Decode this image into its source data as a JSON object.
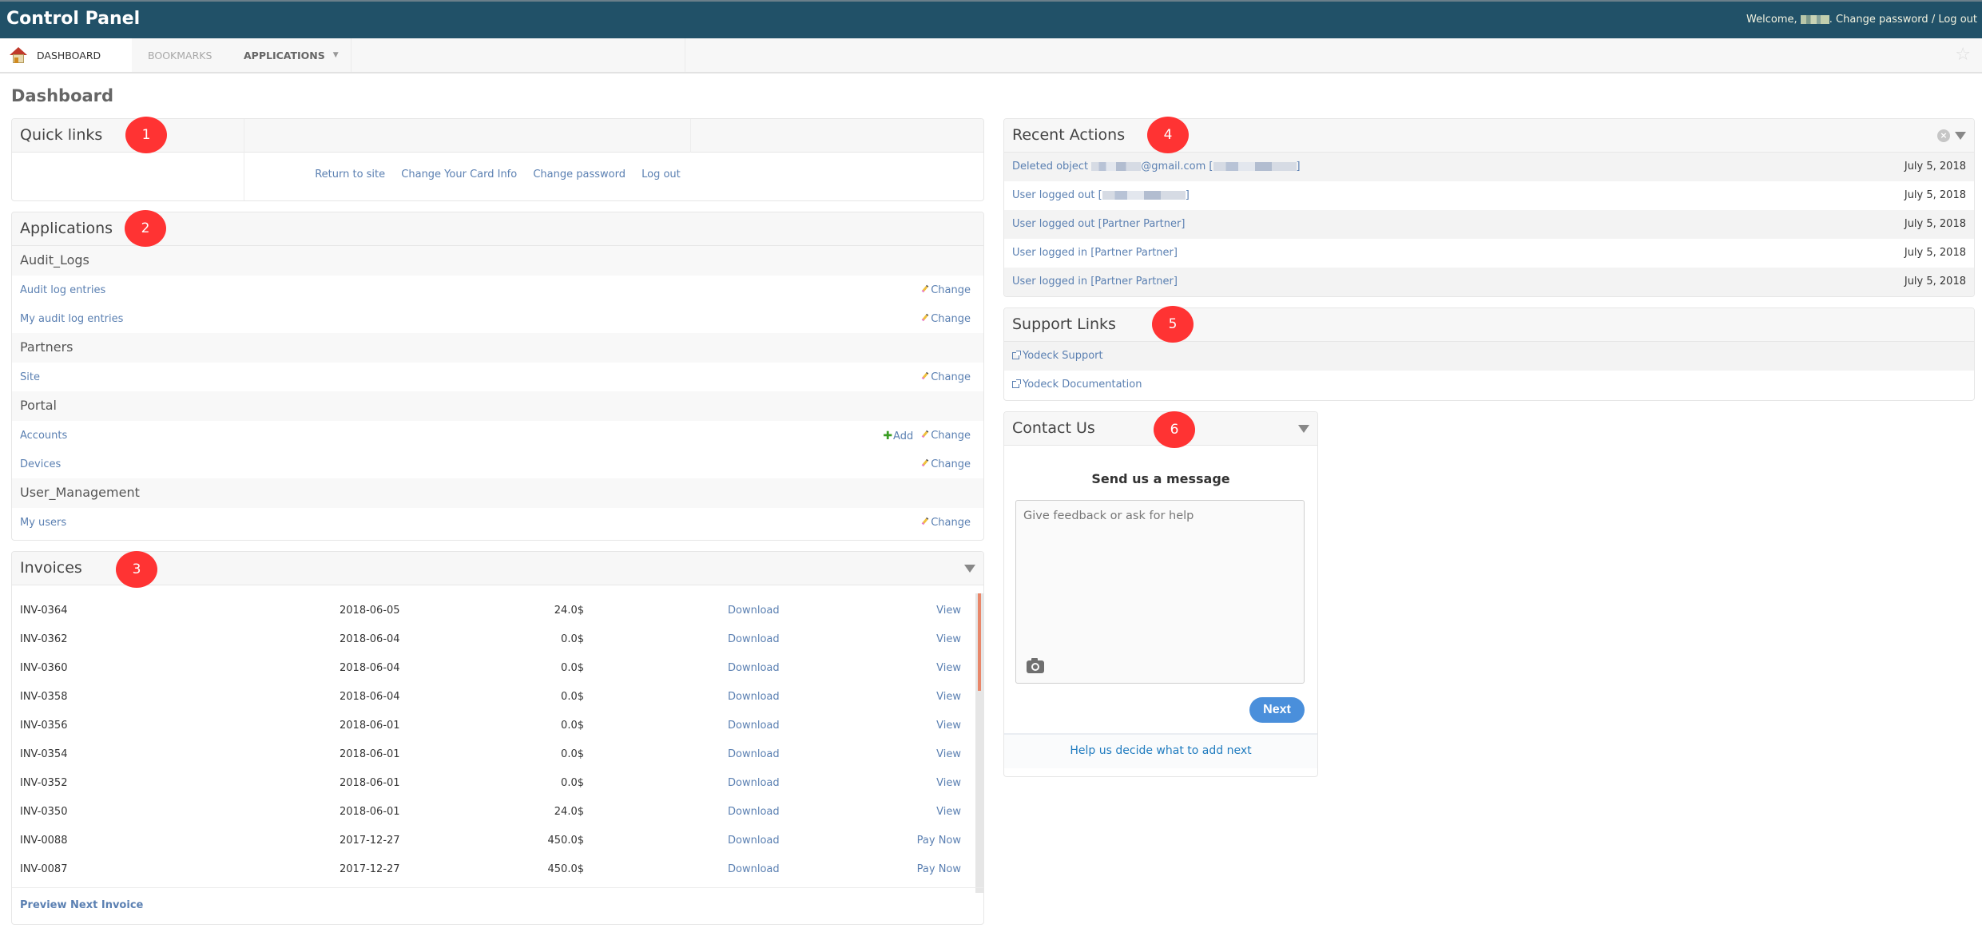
{
  "header": {
    "title": "Control Panel",
    "welcome_prefix": "Welcome,",
    "welcome_suffix": ".",
    "change_password": "Change password",
    "separator": "/",
    "log_out": "Log out"
  },
  "nav": {
    "tabs": [
      {
        "label": "DASHBOARD",
        "icon": "home-icon",
        "active": true
      },
      {
        "label": "BOOKMARKS"
      },
      {
        "label": "APPLICATIONS",
        "icon": "caret-down-icon"
      }
    ],
    "bookmark_icon": "star-icon"
  },
  "page": {
    "title": "Dashboard"
  },
  "colors": {
    "header_bg": "#215168",
    "link": "#5b80b2",
    "badge": "#ff3333",
    "next_button": "#4a8fdb",
    "scroll_thumb": "#e9876a"
  },
  "quick_links": {
    "title": "Quick links",
    "badge": "1",
    "links": [
      "Return to site",
      "Change Your Card Info",
      "Change password",
      "Log out"
    ]
  },
  "applications": {
    "title": "Applications",
    "badge": "2",
    "groups": [
      {
        "name": "Audit_Logs",
        "models": [
          {
            "name": "Audit log entries",
            "actions": [
              "Change"
            ]
          },
          {
            "name": "My audit log entries",
            "actions": [
              "Change"
            ]
          }
        ]
      },
      {
        "name": "Partners",
        "models": [
          {
            "name": "Site",
            "actions": [
              "Change"
            ]
          }
        ]
      },
      {
        "name": "Portal",
        "models": [
          {
            "name": "Accounts",
            "add": "Add",
            "actions": [
              "Change"
            ]
          },
          {
            "name": "Devices",
            "actions": [
              "Change"
            ]
          }
        ]
      },
      {
        "name": "User_Management",
        "models": [
          {
            "name": "My users",
            "actions": [
              "Change"
            ]
          }
        ]
      }
    ]
  },
  "invoices": {
    "title": "Invoices",
    "badge": "3",
    "rows": [
      {
        "id": "INV-0364",
        "date": "2018-06-05",
        "amount": "24.0$",
        "download": "Download",
        "action": "View"
      },
      {
        "id": "INV-0362",
        "date": "2018-06-04",
        "amount": "0.0$",
        "download": "Download",
        "action": "View"
      },
      {
        "id": "INV-0360",
        "date": "2018-06-04",
        "amount": "0.0$",
        "download": "Download",
        "action": "View"
      },
      {
        "id": "INV-0358",
        "date": "2018-06-04",
        "amount": "0.0$",
        "download": "Download",
        "action": "View"
      },
      {
        "id": "INV-0356",
        "date": "2018-06-01",
        "amount": "0.0$",
        "download": "Download",
        "action": "View"
      },
      {
        "id": "INV-0354",
        "date": "2018-06-01",
        "amount": "0.0$",
        "download": "Download",
        "action": "View"
      },
      {
        "id": "INV-0352",
        "date": "2018-06-01",
        "amount": "0.0$",
        "download": "Download",
        "action": "View"
      },
      {
        "id": "INV-0350",
        "date": "2018-06-01",
        "amount": "24.0$",
        "download": "Download",
        "action": "View"
      },
      {
        "id": "INV-0088",
        "date": "2017-12-27",
        "amount": "450.0$",
        "download": "Download",
        "action": "Pay Now"
      },
      {
        "id": "INV-0087",
        "date": "2017-12-27",
        "amount": "450.0$",
        "download": "Download",
        "action": "Pay Now"
      }
    ],
    "footer_link": "Preview Next Invoice"
  },
  "recent_actions": {
    "title": "Recent Actions",
    "badge": "4",
    "rows": [
      {
        "prefix": "Deleted object ",
        "mid": "@gmail.com [",
        "suffix": "]",
        "redacted": true,
        "date": "July 5, 2018"
      },
      {
        "prefix": "User logged out [",
        "suffix": "]",
        "redacted": true,
        "date": "July 5, 2018"
      },
      {
        "text": "User logged out [Partner Partner]",
        "date": "July 5, 2018"
      },
      {
        "text": "User logged in [Partner Partner]",
        "date": "July 5, 2018"
      },
      {
        "text": "User logged in [Partner Partner]",
        "date": "July 5, 2018"
      }
    ]
  },
  "support_links": {
    "title": "Support Links",
    "badge": "5",
    "links": [
      "Yodeck Support",
      "Yodeck Documentation"
    ]
  },
  "contact_us": {
    "title": "Contact Us",
    "badge": "6",
    "heading": "Send us a message",
    "placeholder": "Give feedback or ask for help",
    "next_label": "Next",
    "footer_link": "Help us decide what to add next"
  }
}
